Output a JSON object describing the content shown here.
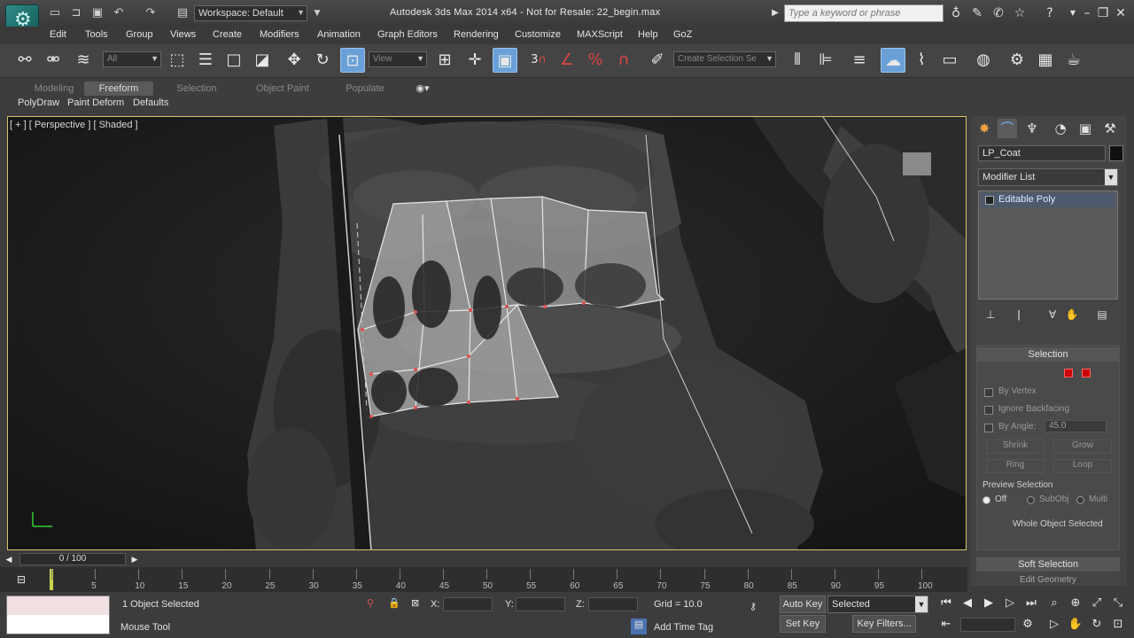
{
  "app": {
    "title": "Autodesk 3ds Max  2014 x64    - Not for Resale:  22_begin.max",
    "workspace": "Workspace: Default",
    "search_placeholder": "Type a keyword or phrase"
  },
  "menu": [
    "Edit",
    "Tools",
    "Group",
    "Views",
    "Create",
    "Modifiers",
    "Animation",
    "Graph Editors",
    "Rendering",
    "Customize",
    "MAXScript",
    "Help",
    "GoZ"
  ],
  "toolbar": {
    "filter": "All",
    "ref_coord": "View",
    "named_sel": "Create Selection Se",
    "snap_label": "3"
  },
  "ribbon": {
    "tabs": [
      "Modeling",
      "Freeform",
      "Selection",
      "Object Paint",
      "Populate"
    ],
    "active_tab": "Freeform",
    "subtabs": [
      "PolyDraw",
      "Paint Deform",
      "Defaults"
    ]
  },
  "viewport": {
    "label": "[ + ] [ Perspective ] [ Shaded ]"
  },
  "command_panel": {
    "object_name": "LP_Coat",
    "modifier_list": "Modifier List",
    "stack": [
      "Editable Poly"
    ],
    "selection": {
      "title": "Selection",
      "by_vertex": "By Vertex",
      "ignore_backfacing": "Ignore Backfacing",
      "by_angle": "By Angle:",
      "angle": "45.0",
      "shrink": "Shrink",
      "grow": "Grow",
      "ring": "Ring",
      "loop": "Loop",
      "preview_title": "Preview Selection",
      "preview": [
        "Off",
        "SubObj",
        "Multi"
      ],
      "status": "Whole Object Selected"
    },
    "soft_selection": "Soft Selection",
    "edit_geometry": "Edit Geometry"
  },
  "timeline": {
    "frame": "0 / 100",
    "ticks": [
      "0",
      "5",
      "10",
      "15",
      "20",
      "25",
      "30",
      "35",
      "40",
      "45",
      "50",
      "55",
      "60",
      "65",
      "70",
      "75",
      "80",
      "85",
      "90",
      "95",
      "100"
    ]
  },
  "status": {
    "selected": "1 Object Selected",
    "prompt": "Mouse Tool",
    "x_label": "X:",
    "y_label": "Y:",
    "z_label": "Z:",
    "grid": "Grid = 10.0",
    "auto_key": "Auto Key",
    "set_key": "Set Key",
    "key_mode": "Selected",
    "key_filters": "Key Filters...",
    "add_time_tag": "Add Time Tag"
  }
}
